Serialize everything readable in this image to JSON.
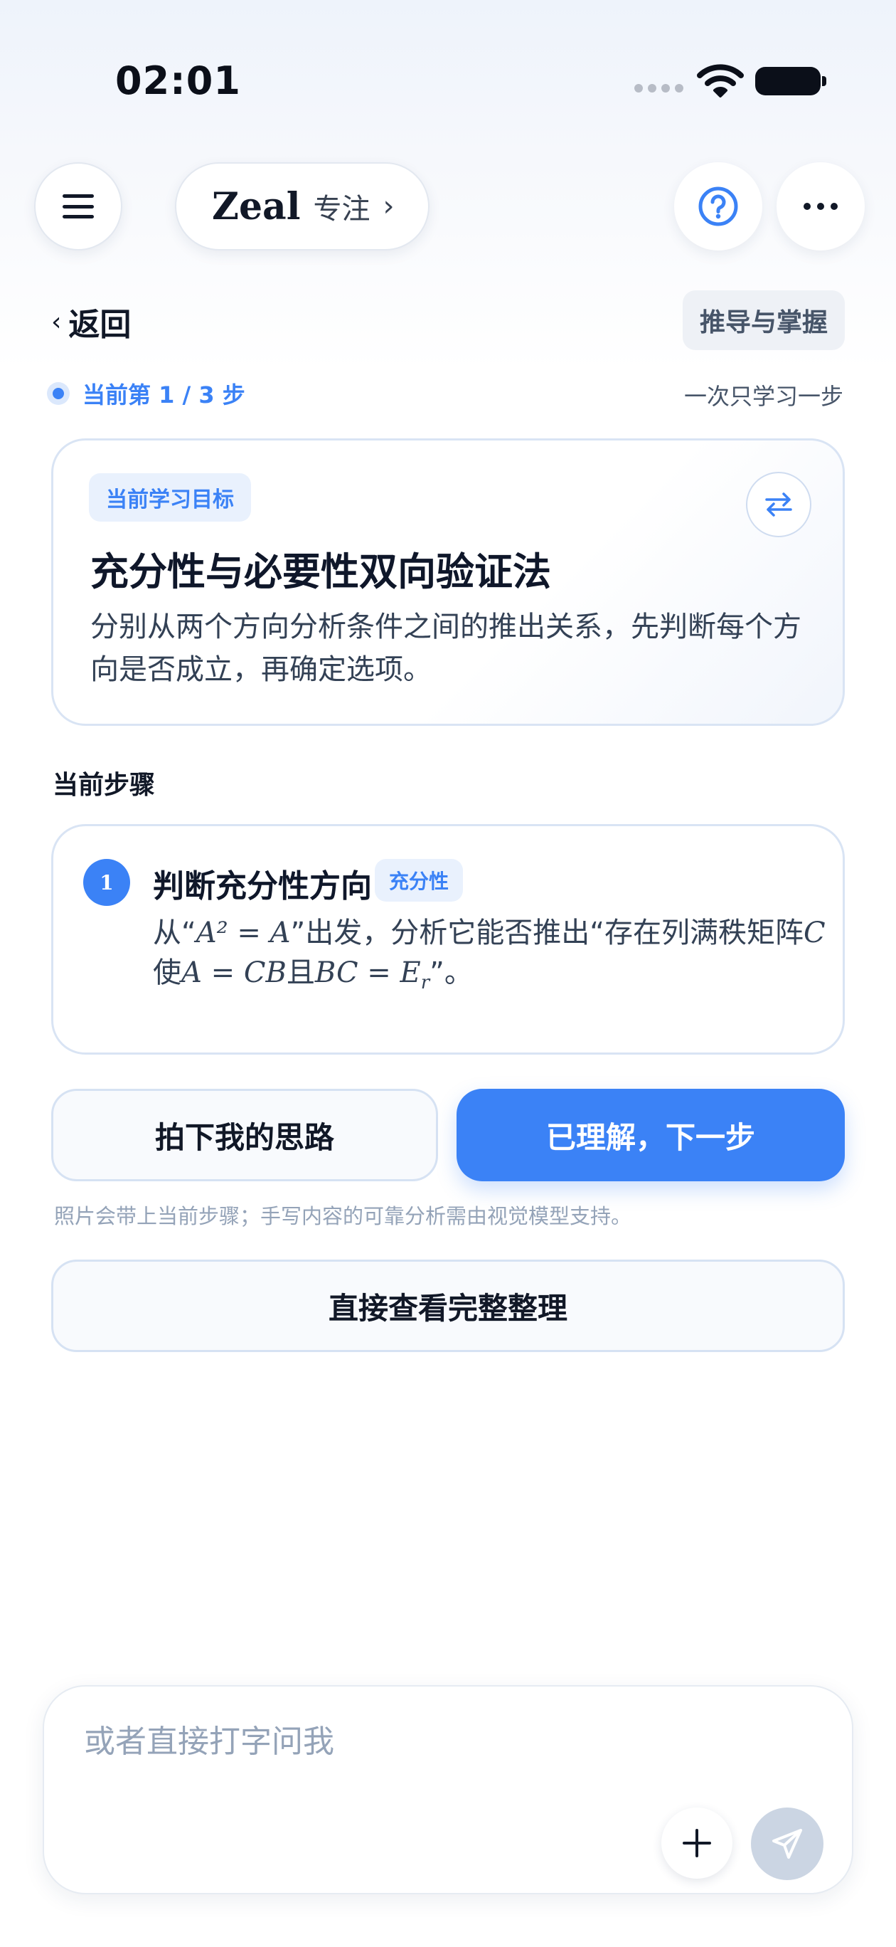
{
  "status_bar": {
    "time": "02:01"
  },
  "header": {
    "brand_name": "Zeal",
    "mode_label": "专注",
    "chevron": "›"
  },
  "nav": {
    "back_label": "返回",
    "back_chevron": "‹",
    "mode_tag": "推导与掌握"
  },
  "progress": {
    "label": "当前第 1 / 3 步",
    "hint": "一次只学习一步"
  },
  "goal": {
    "chip": "当前学习目标",
    "title": "充分性与必要性双向验证法",
    "description": "分别从两个方向分析条件之间的推出关系，先判断每个方向是否成立，再确定选项。"
  },
  "current_step": {
    "section_label": "当前步骤",
    "number": "1",
    "title": "判断充分性方向",
    "chip": "充分性",
    "desc_prefix": "从“",
    "desc_math1": "A² = A",
    "desc_middle": "”出发，分析它能否推出“存在列满秩矩阵",
    "desc_math2": "C",
    "desc_line2_prefix": "使",
    "desc_math3": "A = CB",
    "desc_and": "且",
    "desc_math4": "BC = E",
    "desc_sub": "r",
    "desc_suffix": "”。"
  },
  "actions": {
    "capture_label": "拍下我的思路",
    "next_label": "已理解，下一步",
    "note": "照片会带上当前步骤；手写内容的可靠分析需由视觉模型支持。",
    "view_all_label": "直接查看完整整理"
  },
  "composer": {
    "placeholder": "或者直接打字问我",
    "value": ""
  },
  "colors": {
    "accent": "#3b82f6",
    "send_disabled": "#cbd5e3"
  },
  "icons": [
    "menu-icon",
    "chevron-right-icon",
    "help-circle-icon",
    "more-horizontal-icon",
    "chevron-left-icon",
    "swap-icon",
    "plus-icon",
    "send-icon",
    "wifi-icon",
    "battery-icon",
    "signal-icon"
  ]
}
